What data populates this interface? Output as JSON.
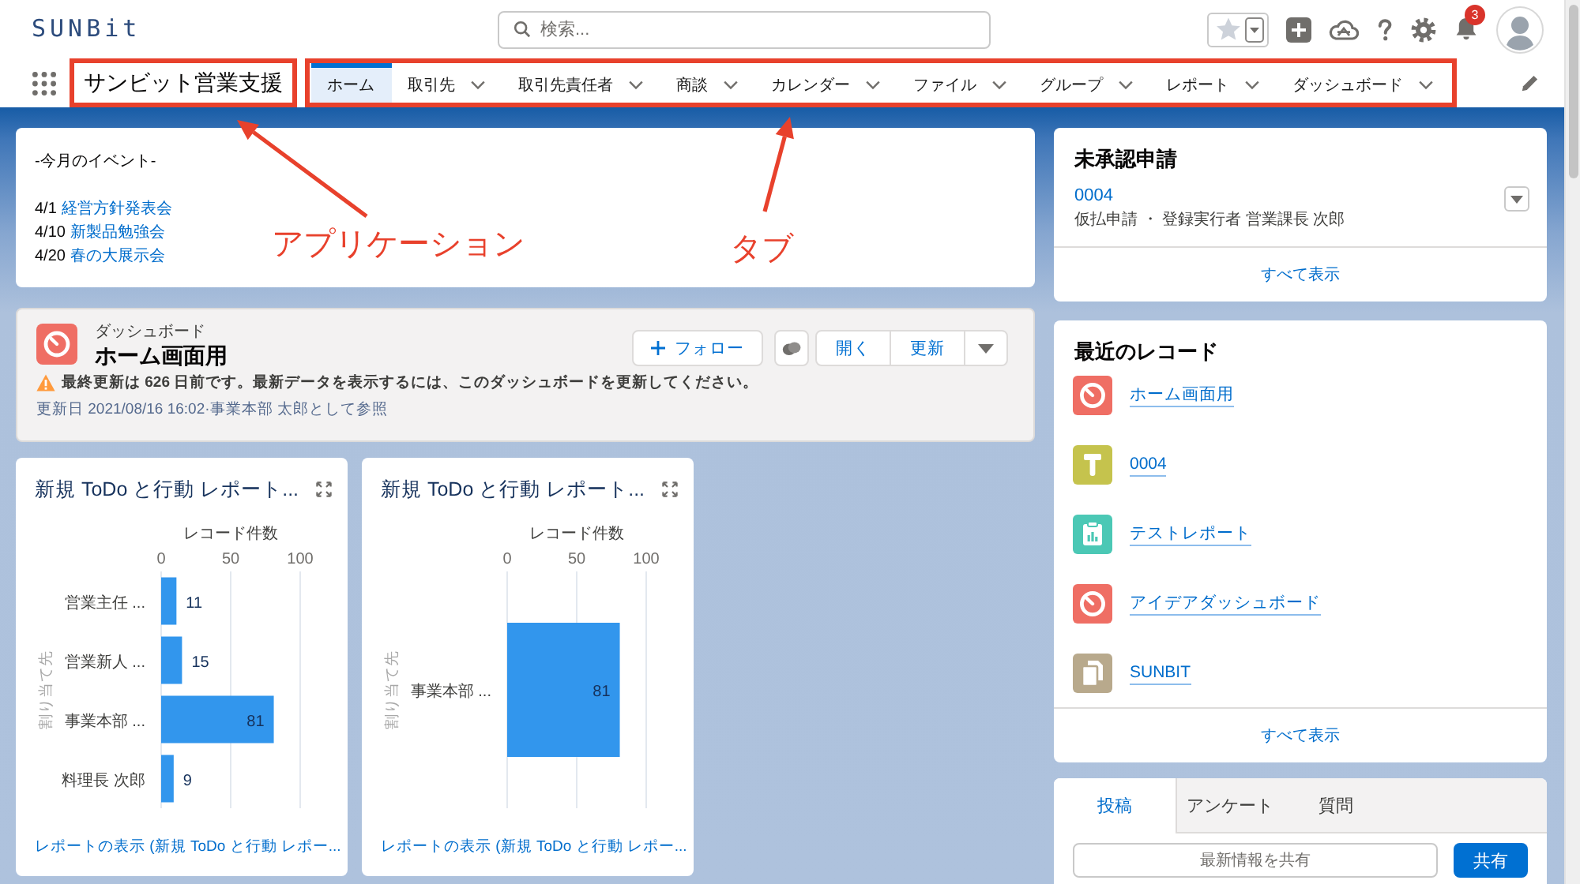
{
  "header": {
    "logo": "SUNBit",
    "search": {
      "placeholder": "検索..."
    },
    "notification_count": "3"
  },
  "nav": {
    "app_name": "サンビット営業支援",
    "app_name_highlighted": true,
    "tabs_highlighted": true,
    "tabs": [
      {
        "label": "ホーム",
        "selected": true,
        "menu": false
      },
      {
        "label": "取引先",
        "selected": false,
        "menu": true
      },
      {
        "label": "取引先責任者",
        "selected": false,
        "menu": true
      },
      {
        "label": "商談",
        "selected": false,
        "menu": true
      },
      {
        "label": "カレンダー",
        "selected": false,
        "menu": true
      },
      {
        "label": "ファイル",
        "selected": false,
        "menu": true
      },
      {
        "label": "グループ",
        "selected": false,
        "menu": true
      },
      {
        "label": "レポート",
        "selected": false,
        "menu": true
      },
      {
        "label": "ダッシュボード",
        "selected": false,
        "menu": true
      }
    ]
  },
  "events": {
    "heading": "-今月のイベント-",
    "items": [
      {
        "date": "4/1",
        "title": "経営方針発表会"
      },
      {
        "date": "4/10",
        "title": "新製品勉強会"
      },
      {
        "date": "4/20",
        "title": "春の大展示会"
      }
    ]
  },
  "dashboard": {
    "type_label": "ダッシュボード",
    "title": "ホーム画面用",
    "warning": "最終更新は 626 日前です。最新データを表示するには、このダッシュボードを更新してください。",
    "updated": "更新日 2021/08/16 16:02·事業本部 太郎として参照",
    "buttons": [
      {
        "kind": "follow",
        "label": "フォロー"
      },
      {
        "kind": "icon"
      },
      {
        "kind": "text",
        "label": "開く"
      },
      {
        "kind": "text",
        "label": "更新"
      },
      {
        "kind": "menu"
      }
    ]
  },
  "charts": [
    {
      "title": "新規 ToDo と行動 レポート...",
      "footer_link": "レポートの表示 (新規 ToDo と行動 レポー...",
      "chart_data": {
        "type": "bar",
        "orientation": "horizontal",
        "xlabel": "レコード件数",
        "ylabel": "割り当て先",
        "categories": [
          "営業主任 ...",
          "営業新人 ...",
          "事業本部 ...",
          "料理長 次郎"
        ],
        "values": [
          11,
          15,
          81,
          9
        ],
        "xlim": [
          0,
          100
        ],
        "xticks": [
          0,
          50,
          100
        ],
        "data_labels": true
      }
    },
    {
      "title": "新規 ToDo と行動 レポート...",
      "footer_link": "レポートの表示 (新規 ToDo と行動 レポー...",
      "chart_data": {
        "type": "bar",
        "orientation": "horizontal",
        "xlabel": "レコード件数",
        "ylabel": "割り当て先",
        "categories": [
          "事業本部 ..."
        ],
        "values": [
          81
        ],
        "xlim": [
          0,
          100
        ],
        "xticks": [
          0,
          50,
          100
        ],
        "data_labels": true
      }
    }
  ],
  "approvals": {
    "title": "未承認申請",
    "items": [
      {
        "name": "0004",
        "detail": "仮払申請 ・ 登録実行者 営業課長 次郎"
      }
    ],
    "view_all": "すべて表示"
  },
  "recent_records": {
    "title": "最近のレコード",
    "items": [
      {
        "kind": "dashboard",
        "label": "ホーム画面用",
        "color": "#ef6e64"
      },
      {
        "kind": "custom",
        "label": "0004",
        "color": "#c5c34d"
      },
      {
        "kind": "report",
        "label": "テストレポート",
        "color": "#4bc8b5"
      },
      {
        "kind": "dashboard",
        "label": "アイデアダッシュボード",
        "color": "#ef6e64"
      },
      {
        "kind": "file",
        "label": "SUNBIT",
        "color": "#b8a98c"
      }
    ],
    "view_all": "すべて表示"
  },
  "feed": {
    "tabs": [
      {
        "label": "投稿",
        "selected": true
      },
      {
        "label": "アンケート",
        "selected": false
      },
      {
        "label": "質問",
        "selected": false
      }
    ],
    "placeholder": "最新情報を共有",
    "share_button": "共有"
  },
  "annotations": [
    {
      "text": "アプリケーション"
    },
    {
      "text": "タブ"
    }
  ]
}
